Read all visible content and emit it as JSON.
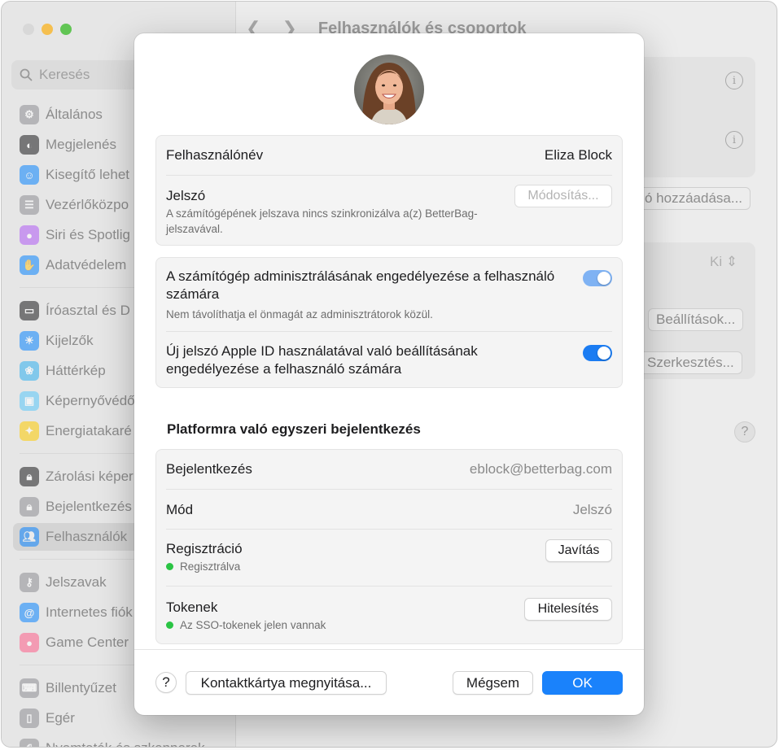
{
  "window": {
    "title": "Felhasználók és csoportok",
    "search_placeholder": "Keresés"
  },
  "sidebar": {
    "items": [
      {
        "label": "Általános",
        "icon": "gear-icon",
        "color": "#8e8e93"
      },
      {
        "label": "Megjelenés",
        "icon": "appearance-icon",
        "color": "#1c1c1e"
      },
      {
        "label": "Kisegítő lehet",
        "icon": "accessibility-icon",
        "color": "#0a84ff"
      },
      {
        "label": "Vezérlőközpo",
        "icon": "control-center-icon",
        "color": "#8e8e93"
      },
      {
        "label": "Siri és Spotlig",
        "icon": "siri-icon",
        "color": "#b15cf5"
      },
      {
        "label": "Adatvédelem",
        "icon": "hand-icon",
        "color": "#0a84ff"
      },
      {
        "label": "Íróasztal és D",
        "icon": "desktop-dock-icon",
        "color": "#1c1c1e"
      },
      {
        "label": "Kijelzők",
        "icon": "display-icon",
        "color": "#0a84ff"
      },
      {
        "label": "Háttérkép",
        "icon": "wallpaper-icon",
        "color": "#30b0f0"
      },
      {
        "label": "Képernyővédő",
        "icon": "screensaver-icon",
        "color": "#5ac8fa"
      },
      {
        "label": "Energiatakaré",
        "icon": "energy-icon",
        "color": "#ffcc00"
      },
      {
        "label": "Zárolási képer",
        "icon": "lock-screen-icon",
        "color": "#1c1c1e"
      },
      {
        "label": "Bejelentkezés",
        "icon": "login-lock-icon",
        "color": "#8e8e93"
      },
      {
        "label": "Felhasználók",
        "icon": "users-icon",
        "color": "#0a84ff"
      },
      {
        "label": "Jelszavak",
        "icon": "key-icon",
        "color": "#8e8e93"
      },
      {
        "label": "Internetes fiók",
        "icon": "at-icon",
        "color": "#0a84ff"
      },
      {
        "label": "Game Center",
        "icon": "game-center-icon",
        "color": "#ff5e8a"
      },
      {
        "label": "Billentyűzet",
        "icon": "keyboard-icon",
        "color": "#8e8e93"
      },
      {
        "label": "Egér",
        "icon": "mouse-icon",
        "color": "#8e8e93"
      },
      {
        "label": "Nyomtatók és szkennerek",
        "icon": "printer-icon",
        "color": "#8e8e93"
      }
    ]
  },
  "background": {
    "add_button": "ó hozzáadása...",
    "select_value": "Ki",
    "settings_button": "Beállítások...",
    "edit_button": "Szerkesztés..."
  },
  "dialog": {
    "account": {
      "username_label": "Felhasználónév",
      "username_value": "Eliza Block",
      "password_label": "Jelszó",
      "password_note": "A számítógépének jelszava nincs szinkronizálva a(z) BetterBag-jelszavával.",
      "change_button": "Módosítás..."
    },
    "permissions": {
      "admin_label": "A számítógép adminisztrálásának engedélyezése a felhasználó számára",
      "admin_note": "Nem távolíthatja el önmagát az adminisztrátorok közül.",
      "admin_enabled": true,
      "appleid_label": "Új jelszó Apple ID használatával való beállításának engedélyezése a felhasználó számára",
      "appleid_enabled": true
    },
    "sso": {
      "title": "Platformra való egyszeri bejelentkezés",
      "login_label": "Bejelentkezés",
      "login_value": "eblock@betterbag.com",
      "mode_label": "Mód",
      "mode_value": "Jelszó",
      "registration_label": "Regisztráció",
      "registration_status": "Regisztrálva",
      "repair_button": "Javítás",
      "tokens_label": "Tokenek",
      "tokens_status": "Az SSO-tokenek jelen vannak",
      "authenticate_button": "Hitelesítés",
      "status_color": "#2ac444"
    },
    "footer": {
      "help": "?",
      "open_contact": "Kontaktkártya megnyitása...",
      "cancel": "Mégsem",
      "ok": "OK"
    }
  }
}
